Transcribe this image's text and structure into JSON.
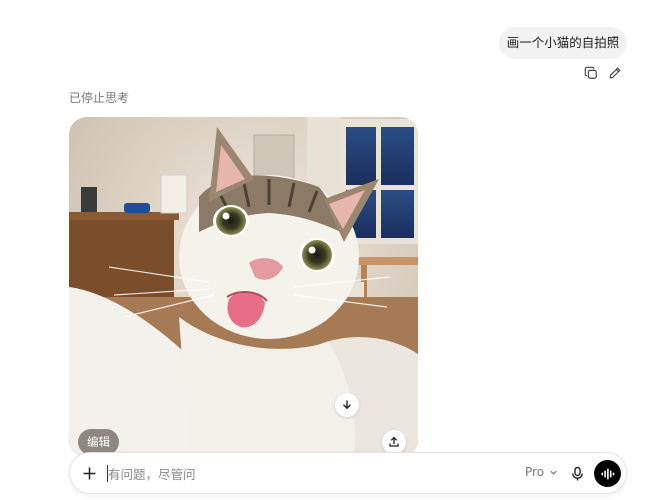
{
  "conversation": {
    "user_message": "画一个小猫的自拍照",
    "actions": {
      "copy_icon": "copy-icon",
      "edit_icon": "pencil-icon"
    },
    "status": "已停止思考"
  },
  "generated_image": {
    "subject": "cat-selfie",
    "edit_label": "编辑",
    "download_icon": "download-icon",
    "share_icon": "share-icon"
  },
  "composer": {
    "placeholder": "有问题，尽管问",
    "value": "",
    "model": "Pro",
    "plus_icon": "plus-icon",
    "mic_icon": "mic-icon",
    "voice_icon": "voice-waveform-icon"
  },
  "colors": {
    "bubble_bg": "#f2f2f2",
    "voice_btn_bg": "#000000",
    "muted_text": "#777777"
  }
}
